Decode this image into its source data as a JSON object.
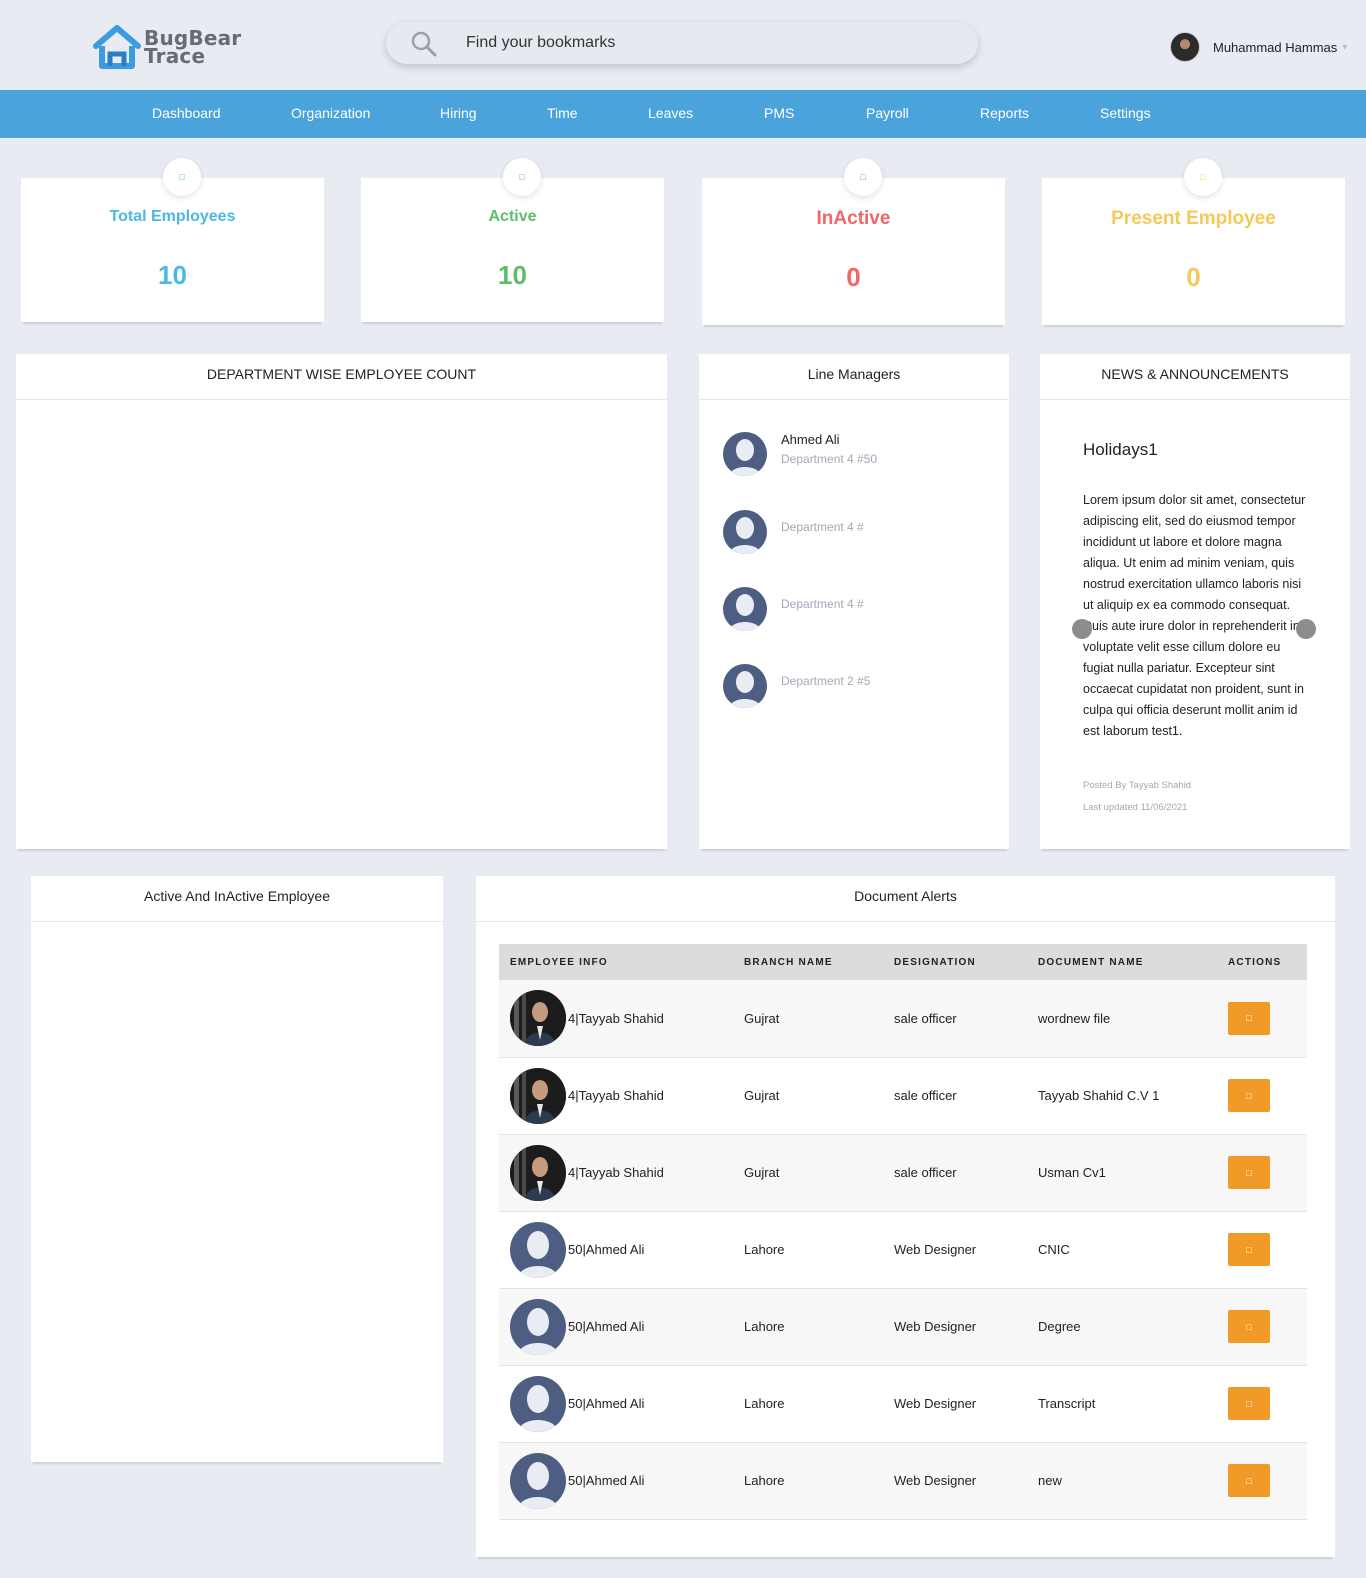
{
  "header": {
    "logo_line1": "BugBear",
    "logo_line2": "Trace",
    "search_placeholder": "Find your bookmarks",
    "user_name": "Muhammad Hammas"
  },
  "nav": [
    "Dashboard",
    "Organization",
    "Hiring",
    "Time",
    "Leaves",
    "PMS",
    "Payroll",
    "Reports",
    "Settings"
  ],
  "stats": [
    {
      "label": "Total Employees",
      "value": "10",
      "color": "#4bb8e6"
    },
    {
      "label": "Active",
      "value": "10",
      "color": "#5fbd6a"
    },
    {
      "label": "InActive",
      "value": "0",
      "color": "#f06565"
    },
    {
      "label": "Present Employee",
      "value": "0",
      "color": "#f5c85a"
    }
  ],
  "panels": {
    "dept_title": "DEPARTMENT WISE EMPLOYEE COUNT",
    "line_managers_title": "Line Managers",
    "news_title": "NEWS & ANNOUNCEMENTS",
    "active_inactive_title": "Active And InActive Employee",
    "doc_alerts_title": "Document Alerts"
  },
  "line_managers": [
    {
      "name": "Ahmed Ali",
      "dept": "Department 4 #50"
    },
    {
      "name": "",
      "dept": "Department 4 #"
    },
    {
      "name": "",
      "dept": "Department 4 #"
    },
    {
      "name": "",
      "dept": "Department 2 #5"
    }
  ],
  "news": {
    "title": "Holidays1",
    "body": "Lorem ipsum dolor sit amet, consectetur adipiscing elit, sed do eiusmod tempor incididunt ut labore et dolore magna aliqua. Ut enim ad minim veniam, quis nostrud exercitation ullamco laboris nisi ut aliquip ex ea commodo consequat. Duis aute irure dolor in reprehenderit in voluptate velit esse cillum dolore eu fugiat nulla pariatur. Excepteur sint occaecat cupidatat non proident, sunt in culpa qui officia deserunt mollit anim id est laborum test1.",
    "posted_by": "Posted By Tayyab Shahid",
    "last_updated": "Last updated 11/06/2021"
  },
  "doc_table": {
    "headers": [
      "EMPLOYEE INFO",
      "BRANCH NAME",
      "DESIGNATION",
      "DOCUMENT NAME",
      "ACTIONS"
    ],
    "rows": [
      {
        "employee": "4|Tayyab Shahid",
        "branch": "Gujrat",
        "designation": "sale officer",
        "document": "wordnew file",
        "photo": true
      },
      {
        "employee": "4|Tayyab Shahid",
        "branch": "Gujrat",
        "designation": "sale officer",
        "document": "Tayyab Shahid C.V 1",
        "photo": true
      },
      {
        "employee": "4|Tayyab Shahid",
        "branch": "Gujrat",
        "designation": "sale officer",
        "document": "Usman Cv1",
        "photo": true
      },
      {
        "employee": "50|Ahmed Ali",
        "branch": "Lahore",
        "designation": "Web Designer",
        "document": "CNIC",
        "photo": false
      },
      {
        "employee": "50|Ahmed Ali",
        "branch": "Lahore",
        "designation": "Web Designer",
        "document": "Degree",
        "photo": false
      },
      {
        "employee": "50|Ahmed Ali",
        "branch": "Lahore",
        "designation": "Web Designer",
        "document": "Transcript",
        "photo": false
      },
      {
        "employee": "50|Ahmed Ali",
        "branch": "Lahore",
        "designation": "Web Designer",
        "document": "new",
        "photo": false
      }
    ]
  },
  "colors": {
    "nav_bg": "#4ba3db",
    "action_btn": "#f29a27",
    "logo_blue": "#3b9be0"
  }
}
